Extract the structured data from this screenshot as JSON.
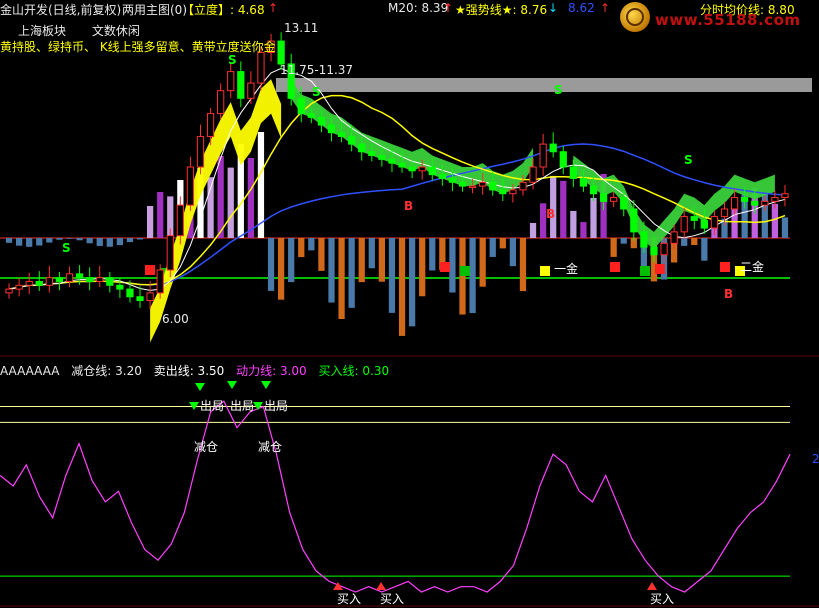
{
  "header": {
    "title": "金山开发(日线,前复权)",
    "main_chart": "两用主图(0)",
    "indicator": "【立度】: 4.68",
    "m20": "M20: 8.39",
    "strong_line": "★强势线★: 8.76",
    "strong_line2": "8.62",
    "avg_price": "分时均价线: 8.80",
    "website": "www.55188.com"
  },
  "legend1": [
    "上海板块",
    "文数休闲"
  ],
  "legend2": "黄持股、绿持币、 K线上强多留意、黄带立度送你金",
  "price_labels": {
    "high": "13.11",
    "zone": "11.75-11.37",
    "low": "6.00"
  },
  "markers": {
    "sell": "S",
    "buy": "B",
    "one_gold": "一金",
    "two_gold": "二金"
  },
  "lower_header": {
    "name": "AAAAAAA",
    "reduce": "减仓线: 3.20",
    "sell": "卖出线: 3.50",
    "power": "动力线: 3.00",
    "buy": "买入线: 0.30"
  },
  "lower_labels": {
    "out": "出局",
    "reduce": "减仓",
    "buy": "买入",
    "axis": "2"
  },
  "colors": {
    "up": "#ff3030",
    "down": "#00ff00",
    "yellow": "#ffff00",
    "magenta": "#ff40ff",
    "cyan": "#00e0ff",
    "white": "#ffffff",
    "gray": "#a0a0a0",
    "blue": "#3050ff",
    "orange": "#d06a1a",
    "steel": "#4a7aaa",
    "purple": "#a030c0"
  },
  "chart_data": [
    {
      "type": "candlestick",
      "title": "金山开发(日线,前复权)",
      "annotations": [
        "13.11",
        "11.75-11.37",
        "6.00",
        "S",
        "B",
        "一金",
        "二金"
      ],
      "series": [
        {
          "name": "close",
          "values": [
            6.4,
            6.5,
            6.6,
            6.5,
            6.7,
            6.6,
            6.8,
            6.7,
            6.6,
            6.7,
            6.5,
            6.4,
            6.2,
            6.1,
            6.3,
            6.9,
            7.8,
            8.6,
            9.6,
            10.4,
            11.0,
            11.6,
            12.1,
            11.4,
            11.8,
            12.6,
            12.9,
            12.3,
            11.4,
            11.0,
            10.9,
            10.7,
            10.5,
            10.4,
            10.2,
            10.0,
            9.9,
            9.8,
            9.7,
            9.6,
            9.5,
            9.6,
            9.4,
            9.3,
            9.2,
            9.1,
            9.1,
            9.2,
            9.0,
            8.9,
            9.0,
            9.2,
            9.6,
            10.2,
            10.0,
            9.6,
            9.3,
            9.1,
            8.9,
            8.7,
            8.8,
            8.5,
            7.9,
            7.5,
            7.3,
            7.6,
            7.9,
            8.3,
            8.2,
            8.0,
            8.3,
            8.5,
            8.8,
            8.7,
            8.6,
            8.7,
            8.8,
            8.9
          ]
        }
      ]
    },
    {
      "type": "line",
      "title": "AAAAAAA",
      "series": [
        {
          "name": "动力线",
          "values": [
            2.2,
            2.0,
            2.4,
            1.8,
            1.4,
            2.2,
            2.8,
            2.1,
            1.7,
            1.9,
            1.3,
            0.8,
            0.6,
            0.9,
            1.5,
            2.5,
            3.4,
            3.6,
            3.1,
            3.4,
            3.5,
            2.6,
            1.5,
            0.8,
            0.4,
            0.2,
            0.1,
            0.0,
            0.1,
            0.0,
            0.1,
            0.2,
            0.0,
            0.1,
            0.0,
            0.1,
            0.1,
            0.0,
            0.2,
            0.5,
            1.2,
            2.0,
            2.6,
            2.4,
            1.9,
            1.7,
            2.2,
            1.6,
            1.0,
            0.6,
            0.3,
            0.1,
            0.0,
            0.2,
            0.4,
            0.8,
            1.2,
            1.5,
            1.7,
            2.1,
            2.6
          ]
        }
      ],
      "ylim": [
        0,
        4
      ],
      "reference_lines": [
        3.2,
        3.5,
        0.3
      ]
    }
  ]
}
